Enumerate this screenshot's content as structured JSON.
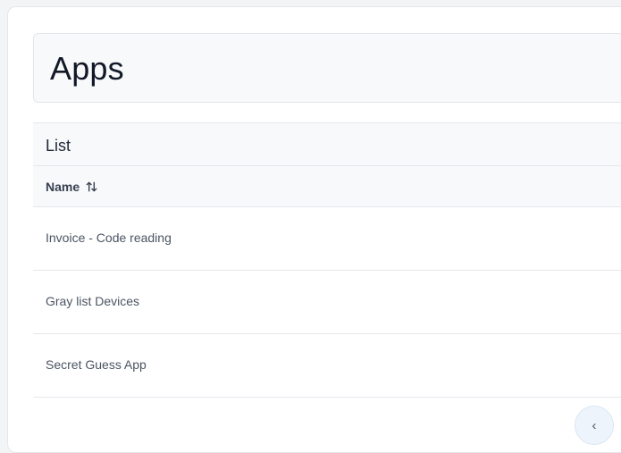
{
  "page": {
    "title": "Apps"
  },
  "list": {
    "title": "List",
    "columns": [
      {
        "label": "Name",
        "sort_icon": "sort-icon"
      }
    ],
    "rows": [
      {
        "name": "Invoice - Code reading"
      },
      {
        "name": "Gray list Devices"
      },
      {
        "name": "Secret Guess App"
      }
    ]
  },
  "pagination": {
    "icon": "chevron-icon"
  }
}
